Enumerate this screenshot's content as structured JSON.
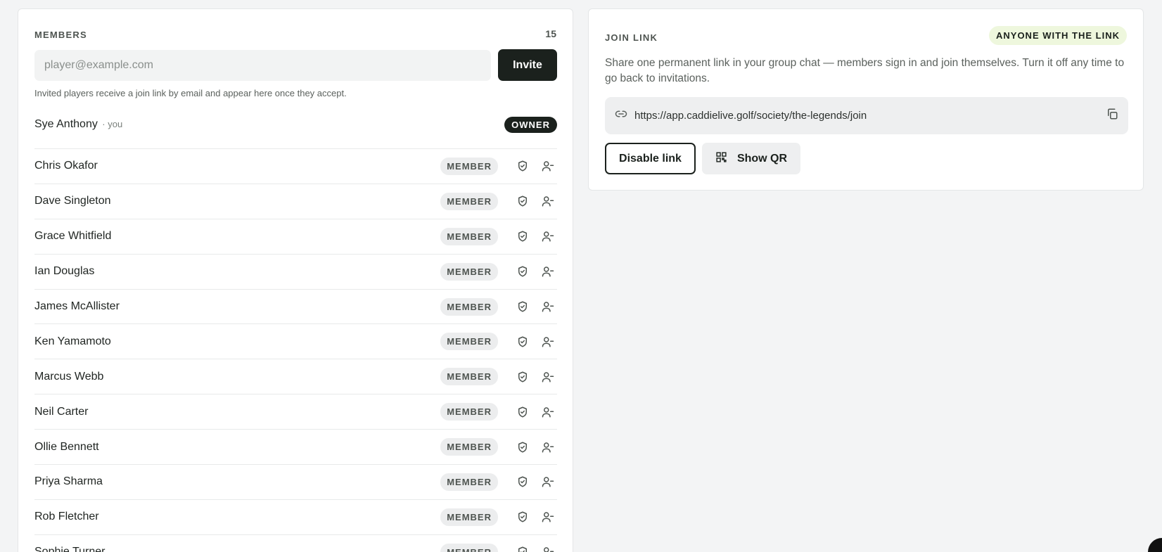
{
  "members": {
    "title": "MEMBERS",
    "count": "15",
    "invite_placeholder": "player@example.com",
    "invite_label": "Invite",
    "helper": "Invited players receive a join link by email and appear here once they accept.",
    "owner": {
      "name": "Sye Anthony",
      "you_tag": "· you",
      "badge": "OWNER"
    },
    "list": [
      {
        "name": "Chris Okafor",
        "role": "MEMBER"
      },
      {
        "name": "Dave Singleton",
        "role": "MEMBER"
      },
      {
        "name": "Grace Whitfield",
        "role": "MEMBER"
      },
      {
        "name": "Ian Douglas",
        "role": "MEMBER"
      },
      {
        "name": "James McAllister",
        "role": "MEMBER"
      },
      {
        "name": "Ken Yamamoto",
        "role": "MEMBER"
      },
      {
        "name": "Marcus Webb",
        "role": "MEMBER"
      },
      {
        "name": "Neil Carter",
        "role": "MEMBER"
      },
      {
        "name": "Ollie Bennett",
        "role": "MEMBER"
      },
      {
        "name": "Priya Sharma",
        "role": "MEMBER"
      },
      {
        "name": "Rob Fletcher",
        "role": "MEMBER"
      },
      {
        "name": "Sophie Turner",
        "role": "MEMBER"
      }
    ],
    "row_icons": [
      "shield-check-icon",
      "remove-user-icon"
    ]
  },
  "join_link": {
    "title": "JOIN LINK",
    "badge": "ANYONE WITH THE LINK",
    "description": "Share one permanent link in your group chat — members sign in and join themselves. Turn it off any time to go back to invitations.",
    "url": "https://app.caddielive.golf/society/the-legends/join",
    "disable_label": "Disable link",
    "qr_label": "Show QR",
    "icons": [
      "link-icon",
      "copy-icon",
      "qr-code-icon"
    ]
  },
  "colors": {
    "background": "#f3f4f5",
    "primary": "#1b211d",
    "accent_pill": "#eef7dd",
    "badge_bg": "#ecedee"
  }
}
